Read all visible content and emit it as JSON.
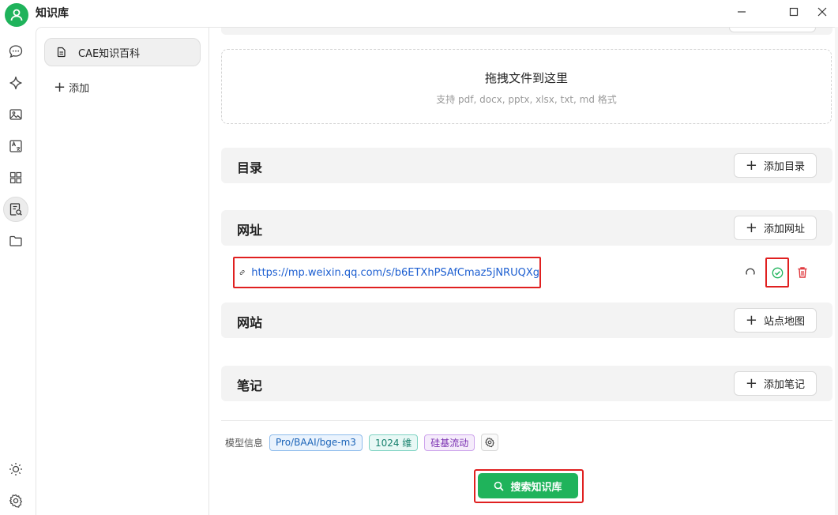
{
  "app": {
    "title": "知识库"
  },
  "sidebar": {
    "items": [
      {
        "label": "CAE知识百科"
      }
    ],
    "add_label": "添加"
  },
  "dropzone": {
    "title": "拖拽文件到这里",
    "subtitle": "支持 pdf, docx, pptx, xlsx, txt, md 格式"
  },
  "sections": {
    "directory": {
      "title": "目录",
      "button": "添加目录"
    },
    "url": {
      "title": "网址",
      "button": "添加网址"
    },
    "website": {
      "title": "网站",
      "button": "站点地图"
    },
    "notes": {
      "title": "笔记",
      "button": "添加笔记"
    }
  },
  "url_items": [
    {
      "url": "https://mp.weixin.qq.com/s/b6ETXhPSAfCmaz5jNRUQXg"
    }
  ],
  "model_info": {
    "label": "模型信息",
    "model": "Pro/BAAI/bge-m3",
    "dimension": "1024 维",
    "provider": "硅基流动"
  },
  "search_button": "搜索知识库",
  "colors": {
    "accent": "#1fb35b",
    "link": "#1d5fd1",
    "highlight": "#e02020",
    "delete": "#e0393e"
  }
}
